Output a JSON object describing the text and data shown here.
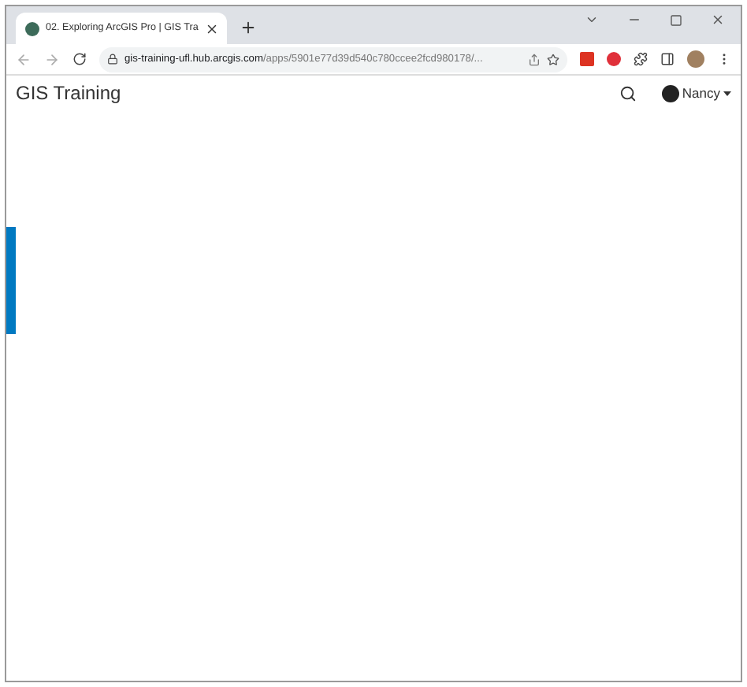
{
  "browser": {
    "tab": {
      "title": "02. Exploring ArcGIS Pro | GIS Tra",
      "selected": true
    },
    "address": {
      "host": "gis-training-ufl.hub.arcgis.com",
      "path": "/apps/5901e77d39d540c780ccee2fcd980178/..."
    }
  },
  "header": {
    "title": "GIS Training",
    "user": "Nancy"
  }
}
